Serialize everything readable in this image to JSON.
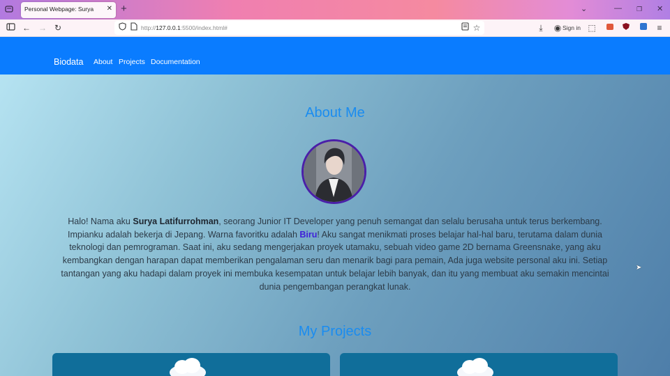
{
  "browser": {
    "tab_title": "Personal Webpage: Surya",
    "url_prefix": "http://",
    "url_host": "127.0.0.1",
    "url_rest": ":5500/index.html#",
    "signin_label": "Sign in",
    "icons": [
      "list-tabs-icon",
      "close-icon",
      "new-tab-icon",
      "chevron-down-icon",
      "minimize-icon",
      "restore-icon",
      "window-close-icon",
      "sidebar-icon",
      "back-icon",
      "forward-icon",
      "reload-icon",
      "shield-icon",
      "page-icon",
      "reader-view-icon",
      "bookmark-star-icon",
      "download-icon",
      "account-icon",
      "extensions-icon",
      "menu-icon"
    ]
  },
  "site": {
    "brand": "Biodata",
    "nav": {
      "about": "About",
      "projects": "Projects",
      "documentation": "Documentation"
    },
    "colors": {
      "navbar": "#0a7cff",
      "title": "#1a8cf0",
      "highlight": "#3f1fd8",
      "avatar_border": "#4a1fa8"
    }
  },
  "about": {
    "title": "About Me",
    "p1": "Halo! Nama aku ",
    "name": "Surya Latifurrohman",
    "p2": ", seorang Junior IT Developer yang penuh semangat dan selalu berusaha untuk terus berkembang. Impianku adalah bekerja di Jepang. Warna favoritku adalah ",
    "color_word": "Biru",
    "p3": "! Aku sangat menikmati proses belajar hal-hal baru, terutama dalam dunia teknologi dan pemrograman. Saat ini, aku sedang mengerjakan proyek utamaku, sebuah video game 2D bernama Greensnake, yang aku kembangkan dengan harapan dapat memberikan pengalaman seru dan menarik bagi para pemain, Ada juga website personal aku ini. Setiap tantangan yang aku hadapi dalam proyek ini membuka kesempatan untuk belajar lebih banyak, dan itu yang membuat aku semakin mencintai dunia pengembangan perangkat lunak."
  },
  "projects": {
    "title": "My Projects"
  }
}
